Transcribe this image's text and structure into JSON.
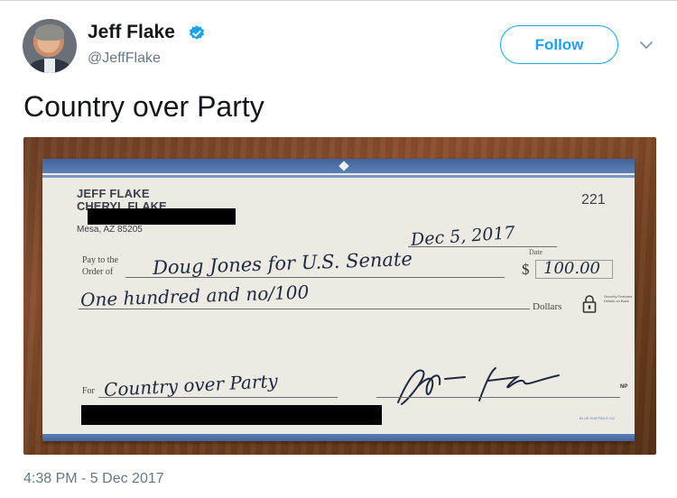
{
  "tweet": {
    "author_name": "Jeff Flake",
    "author_handle": "@JeffFlake",
    "follow_label": "Follow",
    "text": "Country over Party",
    "timestamp": "4:38 PM - 5 Dec 2017",
    "colors": {
      "accent": "#1da1f2",
      "secondary_text": "#657786",
      "primary_text": "#14171a"
    }
  },
  "check": {
    "account_name_1": "JEFF FLAKE",
    "account_name_2": "CHERYL FLAKE",
    "account_city": "Mesa, AZ 85205",
    "check_number": "221",
    "date": "Dec 5, 2017",
    "date_label": "Date",
    "pay_to_label": "Pay to the",
    "order_of_label": "Order of",
    "payee": "Doug Jones for U.S. Senate",
    "dollar_sign": "$",
    "amount": "100.00",
    "amount_words": "One hundred and no/100",
    "dollars_label": "Dollars",
    "security_text": "Security Features Details on Back",
    "for_label": "For",
    "memo": "Country over Party",
    "np_mark": "NP",
    "printer_mark": "BLUE SHIFFIELD CO"
  }
}
